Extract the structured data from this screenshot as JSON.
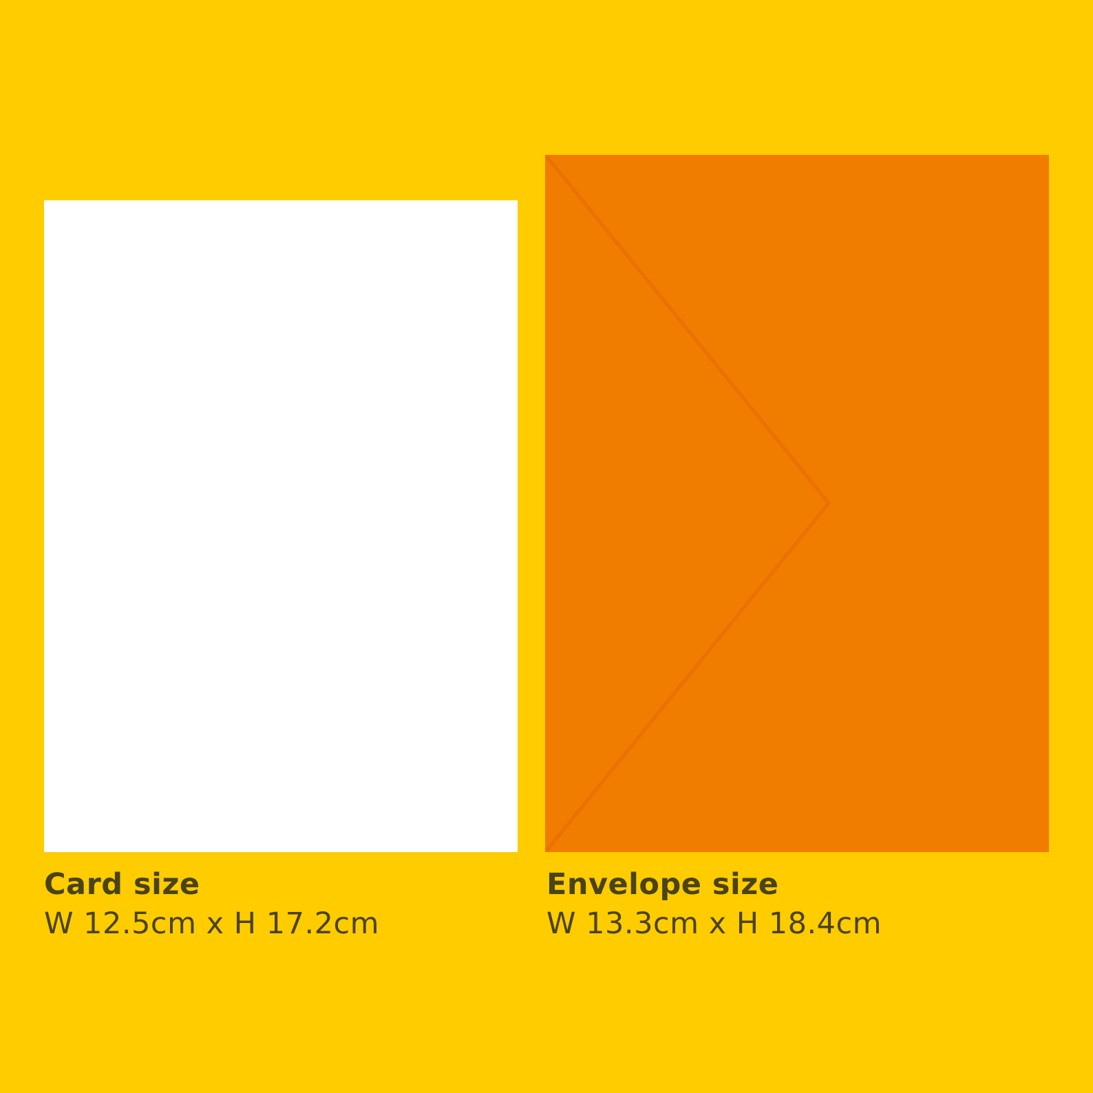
{
  "colors": {
    "background": "#ffcc00",
    "card": "#ffffff",
    "envelope": "#f07d00",
    "envelope_fold_line": "#ea7000",
    "text": "#4a4318"
  },
  "card": {
    "title": "Card size",
    "dimensions": "W 12.5cm x H 17.2cm"
  },
  "envelope": {
    "title": "Envelope size",
    "dimensions": "W 13.3cm x H 18.4cm"
  }
}
